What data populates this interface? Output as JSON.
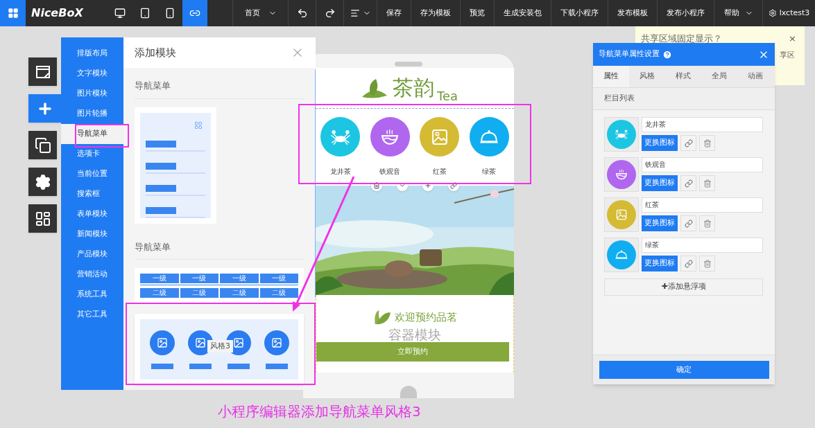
{
  "toolbar": {
    "logo": "NiceBoX",
    "view_modes": [
      {
        "selected": false
      },
      {
        "selected": false
      },
      {
        "selected": false
      },
      {
        "selected": true
      }
    ],
    "home": "首页",
    "actions": [
      "保存",
      "存为模板",
      "预览",
      "生成安装包",
      "下载小程序",
      "发布模板",
      "发布小程序"
    ],
    "help": "帮助",
    "user": "lxctest3"
  },
  "tools": [
    {
      "selected": false
    },
    {
      "selected": true
    },
    {
      "selected": false
    },
    {
      "selected": false
    },
    {
      "selected": false
    }
  ],
  "categories": [
    {
      "label": "排版布局",
      "selected": false
    },
    {
      "label": "文字模块",
      "selected": false
    },
    {
      "label": "图片模块",
      "selected": false
    },
    {
      "label": "图片轮播",
      "selected": false
    },
    {
      "label": "导航菜单",
      "selected": true
    },
    {
      "label": "选项卡",
      "selected": false
    },
    {
      "label": "当前位置",
      "selected": false
    },
    {
      "label": "搜索框",
      "selected": false
    },
    {
      "label": "表单模块",
      "selected": false
    },
    {
      "label": "新闻模块",
      "selected": false
    },
    {
      "label": "产品模块",
      "selected": false
    },
    {
      "label": "营销活动",
      "selected": false
    },
    {
      "label": "系统工具",
      "selected": false
    },
    {
      "label": "其它工具",
      "selected": false
    }
  ],
  "module_panel": {
    "title": "添加模块",
    "sections": [
      {
        "title": "导航菜单",
        "templates": [
          {
            "kind": "list"
          }
        ]
      },
      {
        "title": "导航菜单",
        "templates": [
          {
            "kind": "grid",
            "row_1": [
              "一级",
              "一级",
              "一级",
              "一级"
            ],
            "row_2": [
              "二级",
              "二级",
              "二级",
              "二级"
            ]
          },
          {
            "kind": "icons",
            "tooltip": "风格3"
          }
        ]
      }
    ]
  },
  "phone": {
    "logo": "茶韵",
    "logo_sub": "Tea",
    "nav_items": [
      {
        "label": "龙井茶",
        "color": "#1cc6e2"
      },
      {
        "label": "铁观音",
        "color": "#b066ee"
      },
      {
        "label": "红茶",
        "color": "#d4bb33"
      },
      {
        "label": "绿茶",
        "color": "#10aef0"
      }
    ],
    "welcome": "欢迎预约品茗",
    "container_label": "容器模块",
    "book_button": "立即预约"
  },
  "note": {
    "title": "共享区域固定显示？",
    "body": "享区",
    "close": "×"
  },
  "properties": {
    "title": "导航菜单属性设置",
    "tabs": [
      {
        "label": "属性",
        "selected": true
      },
      {
        "label": "风格",
        "selected": false
      },
      {
        "label": "样式",
        "selected": false
      },
      {
        "label": "全局",
        "selected": false
      },
      {
        "label": "动画",
        "selected": false
      }
    ],
    "section": "栏目列表",
    "items": [
      {
        "value": "龙井茶",
        "color": "#1cc6e2",
        "button": "更换图标"
      },
      {
        "value": "铁观音",
        "color": "#b066ee",
        "button": "更换图标"
      },
      {
        "value": "红茶",
        "color": "#d4bb33",
        "button": "更换图标"
      },
      {
        "value": "绿茶",
        "color": "#10aef0",
        "button": "更换图标"
      }
    ],
    "add_button": "✚添加悬浮项",
    "confirm": "确定"
  },
  "caption": "小程序编辑器添加导航菜单风格3"
}
